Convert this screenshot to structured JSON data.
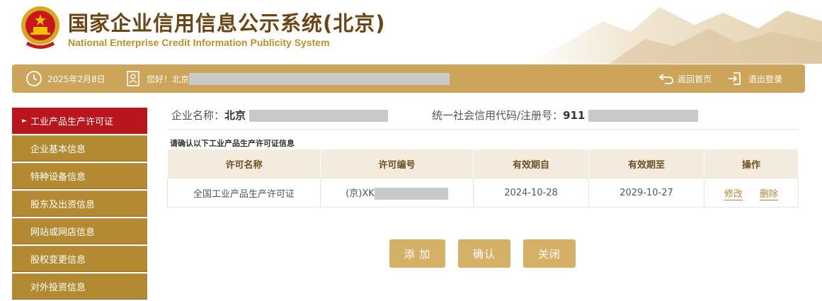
{
  "header": {
    "title_cn": "国家企业信用信息公示系统(北京)",
    "title_en": "National Enterprise Credit Information Publicity System"
  },
  "topbar": {
    "date": "2025年2月8日",
    "greeting": "您好！北京",
    "home_label": "返回首页",
    "logout_label": "退出登录"
  },
  "sidebar": {
    "items": [
      {
        "label": "工业产品生产许可证",
        "active": true
      },
      {
        "label": "企业基本信息",
        "active": false
      },
      {
        "label": "特种设备信息",
        "active": false
      },
      {
        "label": "股东及出资信息",
        "active": false
      },
      {
        "label": "网站或网店信息",
        "active": false
      },
      {
        "label": "股权变更信息",
        "active": false
      },
      {
        "label": "对外投资信息",
        "active": false
      }
    ]
  },
  "main": {
    "company_name_label": "企业名称：",
    "company_name_value": "北京",
    "credit_code_label": "统一社会信用代码/注册号：",
    "credit_code_value": "911",
    "confirm_title": "请确认以下工业产品生产许可证信息",
    "table": {
      "headers": [
        "许可名称",
        "许可编号",
        "有效期自",
        "有效期至",
        "操作"
      ],
      "rows": [
        {
          "name": "全国工业产品生产许可证",
          "number": "(京)XK",
          "from": "2024-10-28",
          "to": "2029-10-27",
          "edit": "修改",
          "delete": "删除"
        }
      ]
    },
    "buttons": {
      "add": "添 加",
      "confirm": "确认",
      "close": "关闭"
    }
  },
  "colors": {
    "gold": "#cda55a",
    "sidebar": "#b38a32",
    "active": "#b8161c",
    "title": "#6b4514"
  }
}
